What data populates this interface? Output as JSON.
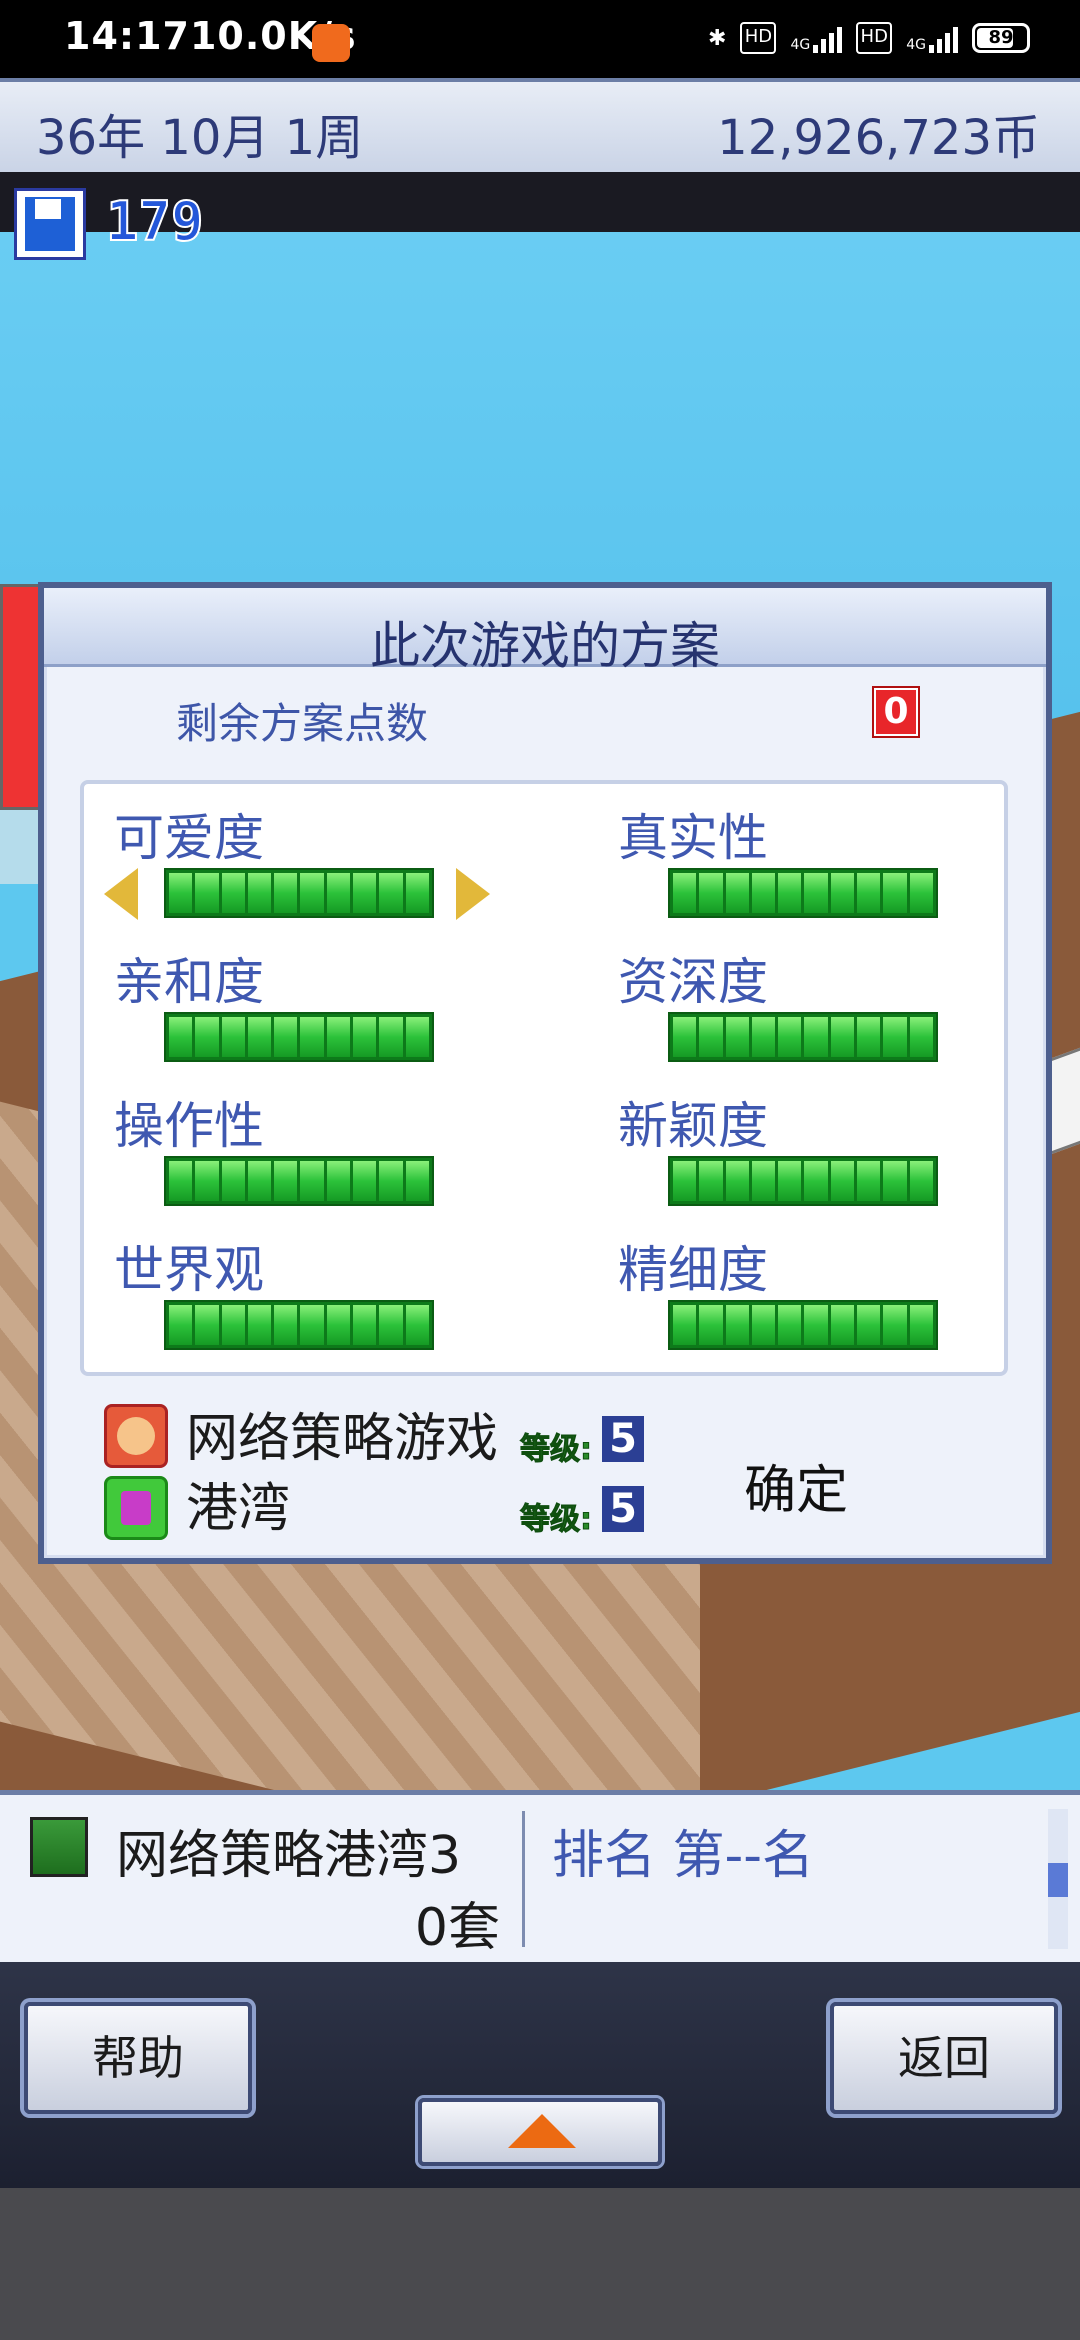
{
  "status_bar": {
    "time": "14:17",
    "net_speed": "10.0K/s",
    "battery": "89",
    "hd1": "HD",
    "hd2": "HD",
    "net1": "4G",
    "net2": "4G"
  },
  "hud": {
    "date": "36年 10月 1周",
    "money": "12,926,723币",
    "save_count": "179"
  },
  "dialog": {
    "title": "此次游戏的方案",
    "points_label": "剩余方案点数",
    "points_value": "0",
    "attributes": [
      {
        "label": "可爱度",
        "level": 10,
        "selected": true
      },
      {
        "label": "真实性",
        "level": 10,
        "selected": false
      },
      {
        "label": "亲和度",
        "level": 10,
        "selected": false
      },
      {
        "label": "资深度",
        "level": 10,
        "selected": false
      },
      {
        "label": "操作性",
        "level": 10,
        "selected": false
      },
      {
        "label": "新颖度",
        "level": 10,
        "selected": false
      },
      {
        "label": "世界观",
        "level": 10,
        "selected": false
      },
      {
        "label": "精细度",
        "level": 10,
        "selected": false
      }
    ],
    "genre": {
      "name": "网络策略游戏",
      "level_label": "等级:",
      "level": "5",
      "icon": "face-icon"
    },
    "theme": {
      "name": "港湾",
      "level_label": "等级:",
      "level": "5",
      "icon": "cube-icon"
    },
    "confirm_label": "确定"
  },
  "info_panel": {
    "game_name": "网络策略港湾3",
    "sales": "0套",
    "rank": "排名 第--名"
  },
  "bottom_bar": {
    "help_label": "帮助",
    "back_label": "返回",
    "up_icon": "up-arrow-icon"
  },
  "colors": {
    "accent_blue": "#3f58b0",
    "bar_green": "#2cc23a",
    "arrow_gold": "#e2b83a",
    "points_red": "#e8262a",
    "up_arrow_orange": "#ec6a12"
  }
}
